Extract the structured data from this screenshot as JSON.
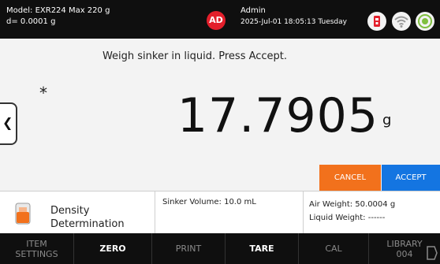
{
  "header": {
    "model_line": "Model: EXR224   Max 220 g",
    "resolution_line": "d= 0.0001 g",
    "avatar_initials": "AD",
    "user_name": "Admin",
    "datetime": "2025-Jul-01 18:05:13 Tuesday",
    "icons": [
      "usb-icon",
      "wifi-icon",
      "level-target-icon"
    ],
    "colors": {
      "avatar": "#e31f2b",
      "usb": "#e31f2b"
    }
  },
  "main": {
    "prompt": "Weigh sinker in liquid. Press Accept.",
    "stability_mark": "*",
    "weight_value": "17.7905",
    "weight_unit": "g",
    "side_tab_icon": "chevron-left-icon",
    "cancel_label": "CANCEL",
    "accept_label": "ACCEPT",
    "colors": {
      "cancel": "#f2711c",
      "accept": "#1475e1"
    }
  },
  "info": {
    "application_label": "Density Determination",
    "application_icon": "beaker-icon",
    "sinker_volume": "Sinker Volume: 10.0 mL",
    "air_weight": "Air Weight: 50.0004 g",
    "liquid_weight": "Liquid Weight: ------"
  },
  "bottom_bar": {
    "item_settings_line1": "ITEM",
    "item_settings_line2": "SETTINGS",
    "zero": "ZERO",
    "print": "PRINT",
    "tare": "TARE",
    "cal": "CAL",
    "library_line1": "LIBRARY",
    "library_line2": "004"
  }
}
